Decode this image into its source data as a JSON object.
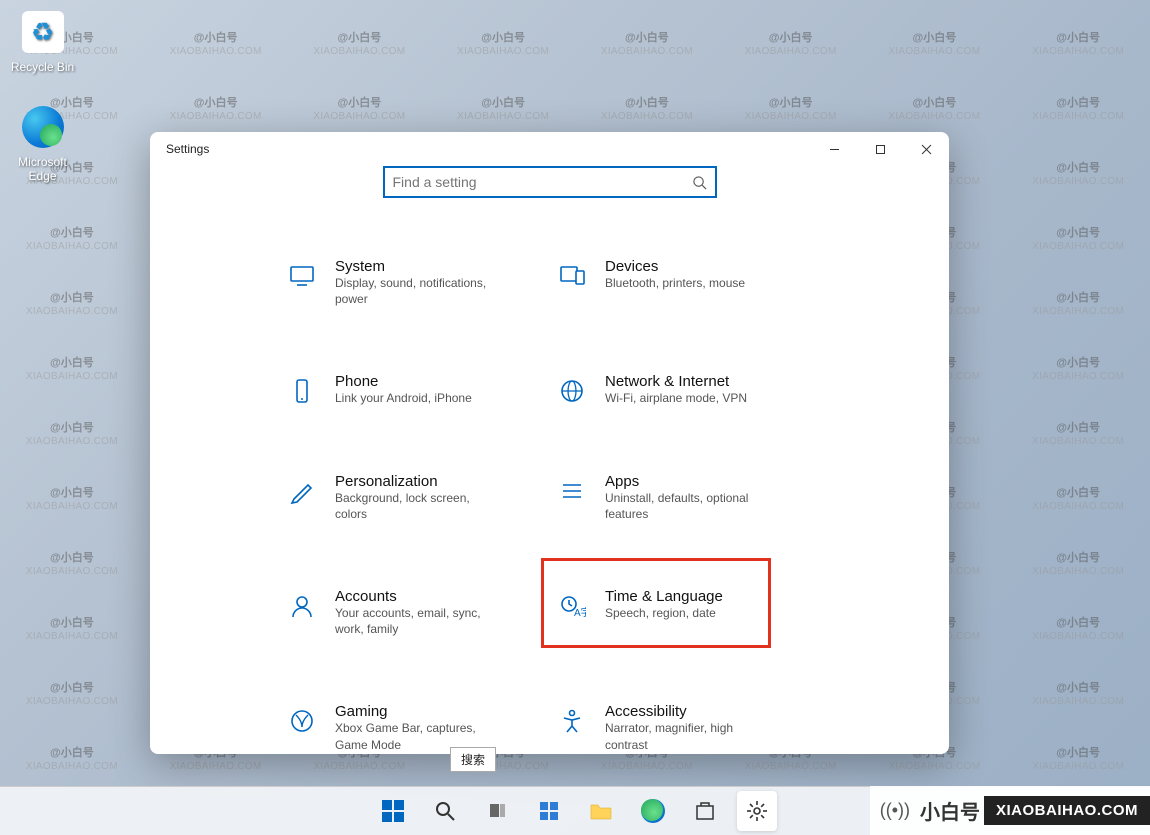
{
  "desktop": {
    "recycle_bin_label": "Recycle Bin",
    "edge_label": "Microsoft Edge"
  },
  "watermark": {
    "line1": "@小白号",
    "line2": "XIAOBAIHAO.COM"
  },
  "window": {
    "title": "Settings",
    "search_placeholder": "Find a setting"
  },
  "categories": [
    {
      "id": "system",
      "title": "System",
      "desc": "Display, sound, notifications, power"
    },
    {
      "id": "devices",
      "title": "Devices",
      "desc": "Bluetooth, printers, mouse"
    },
    {
      "id": "phone",
      "title": "Phone",
      "desc": "Link your Android, iPhone"
    },
    {
      "id": "network",
      "title": "Network & Internet",
      "desc": "Wi-Fi, airplane mode, VPN"
    },
    {
      "id": "personalization",
      "title": "Personalization",
      "desc": "Background, lock screen, colors"
    },
    {
      "id": "apps",
      "title": "Apps",
      "desc": "Uninstall, defaults, optional features"
    },
    {
      "id": "accounts",
      "title": "Accounts",
      "desc": "Your accounts, email, sync, work, family"
    },
    {
      "id": "time",
      "title": "Time & Language",
      "desc": "Speech, region, date"
    },
    {
      "id": "gaming",
      "title": "Gaming",
      "desc": "Xbox Game Bar, captures, Game Mode"
    },
    {
      "id": "accessibility",
      "title": "Accessibility",
      "desc": "Narrator, magnifier, high contrast"
    }
  ],
  "highlighted_category": "time",
  "tooltip": "搜索",
  "tray": {
    "brand": "小白号",
    "domain": "XIAOBAIHAO.COM"
  }
}
